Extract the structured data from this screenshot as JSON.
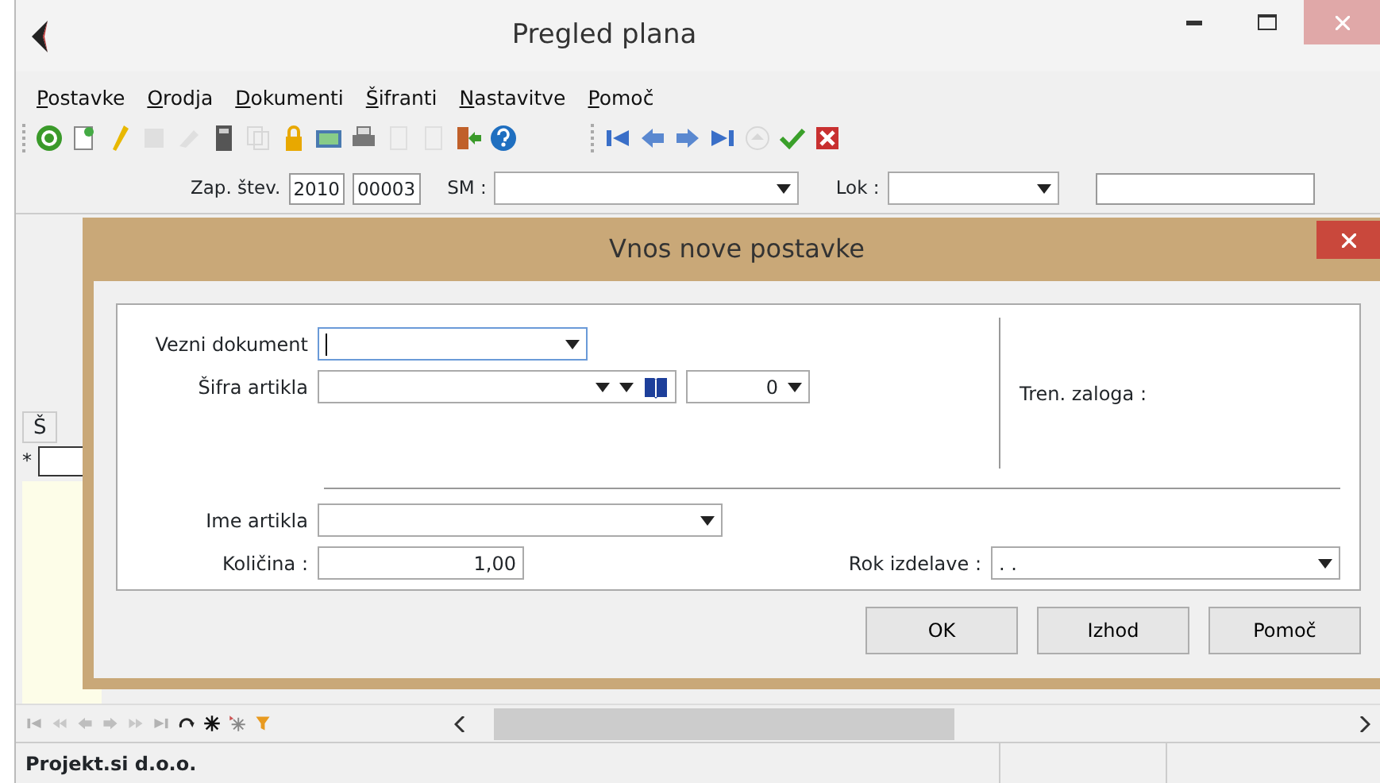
{
  "window": {
    "title": "Pregled plana"
  },
  "menu": [
    "Postavke",
    "Orodja",
    "Dokumenti",
    "Šifranti",
    "Nastavitve",
    "Pomoč"
  ],
  "toolbar": [
    [
      {
        "kind": "refresh",
        "disabled": false
      },
      {
        "kind": "new",
        "disabled": false
      },
      {
        "kind": "edit",
        "disabled": false
      },
      {
        "kind": "copy",
        "disabled": true
      },
      {
        "kind": "erase",
        "disabled": true
      },
      {
        "kind": "calc",
        "disabled": false
      },
      {
        "kind": "pages",
        "disabled": true
      },
      {
        "kind": "lock",
        "disabled": false
      },
      {
        "kind": "card",
        "disabled": false
      },
      {
        "kind": "print",
        "disabled": false
      },
      {
        "kind": "page",
        "disabled": true
      },
      {
        "kind": "page",
        "disabled": true
      },
      {
        "kind": "exit",
        "disabled": false
      },
      {
        "kind": "help",
        "disabled": false
      }
    ],
    [
      {
        "kind": "first",
        "disabled": false
      },
      {
        "kind": "prev",
        "disabled": false
      },
      {
        "kind": "next",
        "disabled": false
      },
      {
        "kind": "last",
        "disabled": false
      },
      {
        "kind": "eject",
        "disabled": true
      },
      {
        "kind": "check",
        "disabled": false
      },
      {
        "kind": "cancel",
        "disabled": false
      }
    ]
  ],
  "filter": {
    "label": "Zap. štev.",
    "year": "2010",
    "number": "00003",
    "sm_label": "SM :",
    "lok_label": "Lok :"
  },
  "grid": {
    "column_1": "Š",
    "new_row_marker": "*"
  },
  "dialog": {
    "title": "Vnos nove postavke",
    "fields": [
      {
        "kind": "combo",
        "label": "Vezni dokument",
        "focused": true
      },
      {
        "kind": "lookup",
        "label": "Šifra artikla",
        "variant": "0"
      },
      {
        "kind": "combo",
        "label": "Ime artikla",
        "focused": false
      },
      {
        "kind": "number",
        "label": "Količina :",
        "value": "1,00"
      }
    ],
    "stock_label": "Tren. zaloga :",
    "deadline": {
      "label": "Rok izdelave :",
      "value": ". ."
    },
    "buttons": [
      "OK",
      "Izhod",
      "Pomoč"
    ]
  },
  "navigator": [
    {
      "kind": "first",
      "disabled": true
    },
    {
      "kind": "fastprev",
      "disabled": true
    },
    {
      "kind": "prev",
      "disabled": true
    },
    {
      "kind": "next",
      "disabled": true
    },
    {
      "kind": "fastnext",
      "disabled": true
    },
    {
      "kind": "last",
      "disabled": true
    },
    {
      "kind": "redo",
      "disabled": false
    },
    {
      "kind": "star",
      "disabled": false
    },
    {
      "kind": "staradd",
      "disabled": false
    },
    {
      "kind": "filter",
      "disabled": false
    }
  ],
  "status_bar": [
    "Projekt.si d.o.o."
  ]
}
